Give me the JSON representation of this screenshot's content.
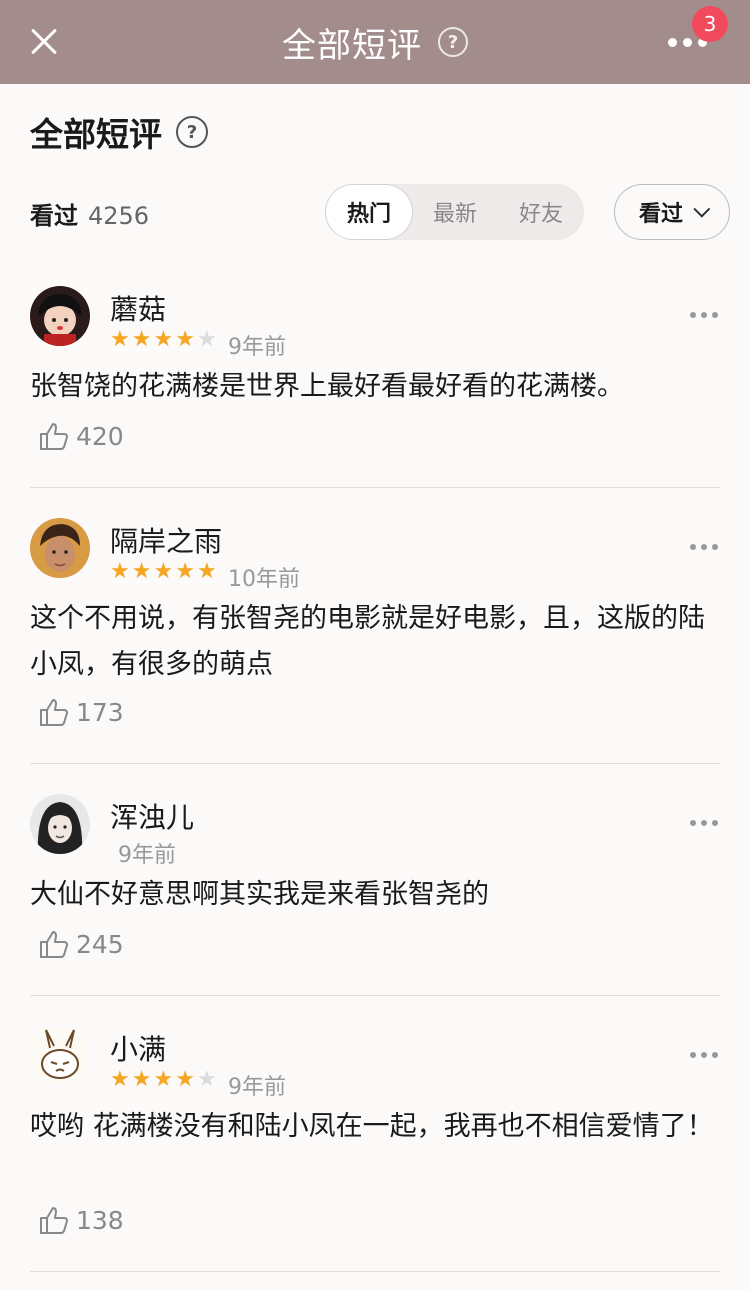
{
  "topbar": {
    "title": "全部短评",
    "help": "?",
    "notification_count": "3"
  },
  "header": {
    "title": "全部短评",
    "help": "?"
  },
  "stats": {
    "label": "看过",
    "count": "4256"
  },
  "sort_tabs": [
    "热门",
    "最新",
    "好友"
  ],
  "active_tab": "热门",
  "filter": {
    "label": "看过"
  },
  "colors": {
    "topbar": "#a38d8c",
    "star": "#f5a623",
    "badge": "#f24a5d"
  },
  "reviews": [
    {
      "name": "蘑菇",
      "rating": 4,
      "time": "9年前",
      "text": "张智饶的花满楼是世界上最好看最好看的花满楼。",
      "likes": "420"
    },
    {
      "name": "隔岸之雨",
      "rating": 5,
      "time": "10年前",
      "text": "这个不用说，有张智尧的电影就是好电影，且，这版的陆小凤，有很多的萌点",
      "likes": "173"
    },
    {
      "name": "浑浊儿",
      "rating": 0,
      "time": "9年前",
      "text": "大仙不好意思啊其实我是来看张智尧的",
      "likes": "245"
    },
    {
      "name": "小满",
      "rating": 4,
      "time": "9年前",
      "text": "哎哟 花满楼没有和陆小凤在一起，我再也不相信爱情了！",
      "likes": "138"
    }
  ]
}
